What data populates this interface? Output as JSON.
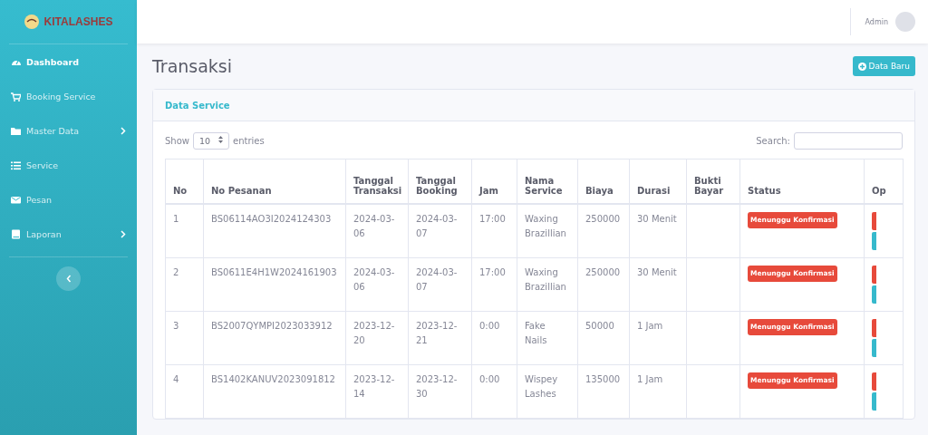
{
  "sidebar": {
    "brand": "KITALASHES",
    "items": [
      {
        "label": "Dashboard",
        "selected": true,
        "expandable": false
      },
      {
        "label": "Booking Service",
        "selected": false,
        "expandable": false
      },
      {
        "label": "Master Data",
        "selected": false,
        "expandable": true
      },
      {
        "label": "Service",
        "selected": false,
        "expandable": false
      },
      {
        "label": "Pesan",
        "selected": false,
        "expandable": false
      },
      {
        "label": "Laporan",
        "selected": false,
        "expandable": true
      }
    ]
  },
  "topbar": {
    "user": "Admin"
  },
  "page": {
    "title": "Transaksi",
    "new_button": "Data Baru"
  },
  "card": {
    "title": "Data Service",
    "show_label": "Show",
    "page_size": "10",
    "entries_label": "entries",
    "search_label": "Search:"
  },
  "table": {
    "columns": [
      "No",
      "No Pesanan",
      "Tanggal Transaksi",
      "Tanggal Booking",
      "Jam",
      "Nama Service",
      "Biaya",
      "Durasi",
      "Bukti Bayar",
      "Status",
      "Op"
    ],
    "rows": [
      {
        "cells": [
          "1",
          "BS06114AO3I2024124303",
          "2024-03-06",
          "2024-03-07",
          "17:00",
          "Waxing Brazillian",
          "250000",
          "30 Menit"
        ],
        "status": "Menunggu Konfirmasi",
        "color": "#e74a3b"
      },
      {
        "cells": [
          "2",
          "BS0611E4H1W2024161903",
          "2024-03-06",
          "2024-03-07",
          "17:00",
          "Waxing Brazillian",
          "250000",
          "30 Menit"
        ],
        "status": "Menunggu Konfirmasi",
        "color": "#e74a3b"
      },
      {
        "cells": [
          "3",
          "BS2007QYMPI2023033912",
          "2023-12-20",
          "2023-12-21",
          "0:00",
          "Fake Nails",
          "50000",
          "1 Jam"
        ],
        "status": "Menunggu Konfirmasi",
        "color": "#e74a3b"
      },
      {
        "cells": [
          "4",
          "BS1402KANUV2023091812",
          "2023-12-14",
          "2023-12-30",
          "0:00",
          "Wispey Lashes",
          "135000",
          "1 Jam"
        ],
        "status": "Menunggu Konfirmasi",
        "color": "#e74a3b"
      }
    ]
  }
}
